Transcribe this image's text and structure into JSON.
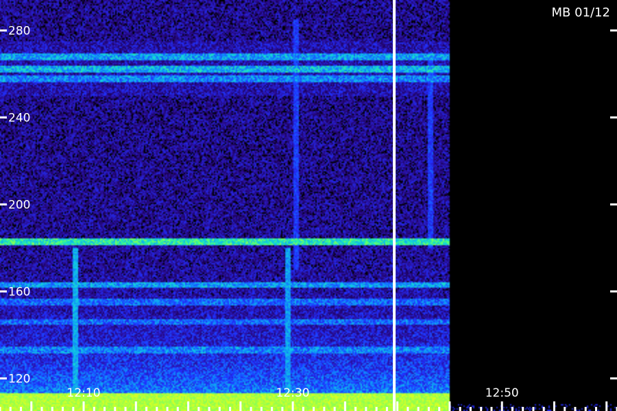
{
  "chart_data": {
    "type": "heatmap",
    "title": "",
    "xlabel": "",
    "ylabel": "",
    "station_badge": "MB 01/12",
    "y_ticks": [
      280,
      240,
      200,
      160,
      120
    ],
    "y_tick_labels": [
      "280",
      "240",
      "200",
      "160",
      "120"
    ],
    "ylim": [
      105,
      294
    ],
    "x_ticks": [
      "12:10",
      "12:30",
      "12:50"
    ],
    "x_tick_minutes": [
      10,
      30,
      50
    ],
    "xlim_minutes": [
      2,
      61
    ],
    "data_end_minute": 45,
    "cursor_minute": 39.7,
    "bright_bands_mhz": [
      {
        "freq": 183,
        "level": 0.75
      },
      {
        "freq": 262,
        "level": 0.55
      },
      {
        "freq": 268,
        "level": 0.5
      },
      {
        "freq": 258,
        "level": 0.45
      },
      {
        "freq": 163,
        "level": 0.55
      },
      {
        "freq": 155,
        "level": 0.45
      },
      {
        "freq": 146,
        "level": 0.45
      },
      {
        "freq": 133,
        "level": 0.5
      }
    ],
    "bursts_minutes": [
      {
        "time": 9.2,
        "fmin": 112,
        "fmax": 180,
        "level": 0.6
      },
      {
        "time": 29.5,
        "fmin": 112,
        "fmax": 180,
        "level": 0.55
      },
      {
        "time": 30.3,
        "fmin": 170,
        "fmax": 285,
        "level": 0.35
      },
      {
        "time": 43.2,
        "fmin": 180,
        "fmax": 270,
        "level": 0.35
      }
    ],
    "colormap": [
      "#1a0050",
      "#2a10a0",
      "#2030ff",
      "#1080ff",
      "#10d0e0",
      "#40ff80",
      "#e0ff20"
    ],
    "grid": false,
    "legend": "none"
  }
}
